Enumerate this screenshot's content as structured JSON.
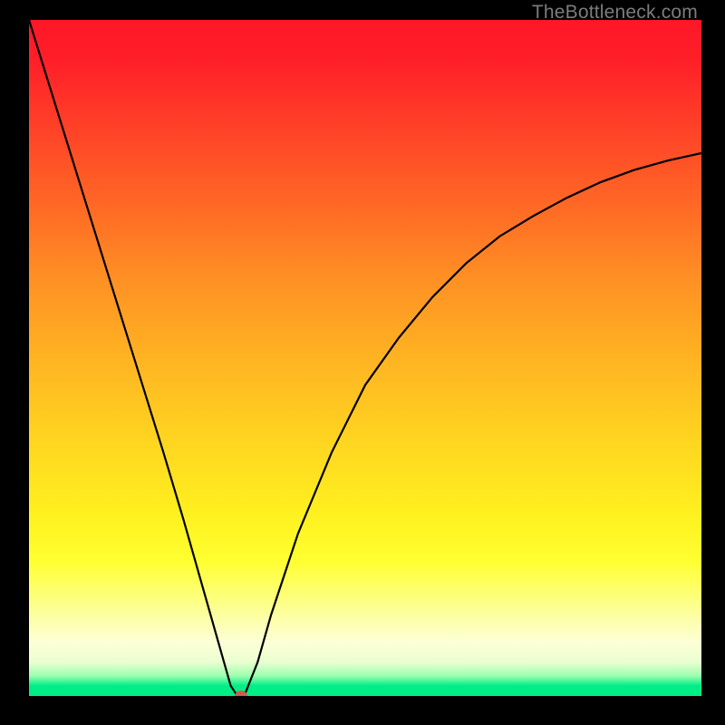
{
  "watermark": "TheBottleneck.com",
  "chart_data": {
    "type": "line",
    "title": "",
    "xlabel": "",
    "ylabel": "",
    "xlim": [
      0,
      100
    ],
    "ylim": [
      0,
      100
    ],
    "grid": false,
    "legend": false,
    "background_gradient": {
      "top": "#ff1728",
      "mid": "#ffd420",
      "bottom": "#00ee86"
    },
    "series": [
      {
        "name": "bottleneck-curve",
        "color": "#000000",
        "x": [
          0,
          5,
          10,
          15,
          20,
          23,
          25,
          27,
          29,
          30,
          31,
          32,
          34,
          36,
          40,
          45,
          50,
          55,
          60,
          65,
          70,
          75,
          80,
          85,
          90,
          95,
          100
        ],
        "values": [
          100,
          84,
          68,
          52,
          36,
          26,
          19,
          12,
          5,
          1.5,
          0,
          0,
          5,
          12,
          24,
          36,
          46,
          53,
          59,
          64,
          68,
          71,
          73.7,
          76,
          77.8,
          79.2,
          80.3
        ]
      }
    ],
    "marker": {
      "name": "red-dot",
      "x": 31.5,
      "y": 0,
      "color": "#d45a4a"
    }
  }
}
